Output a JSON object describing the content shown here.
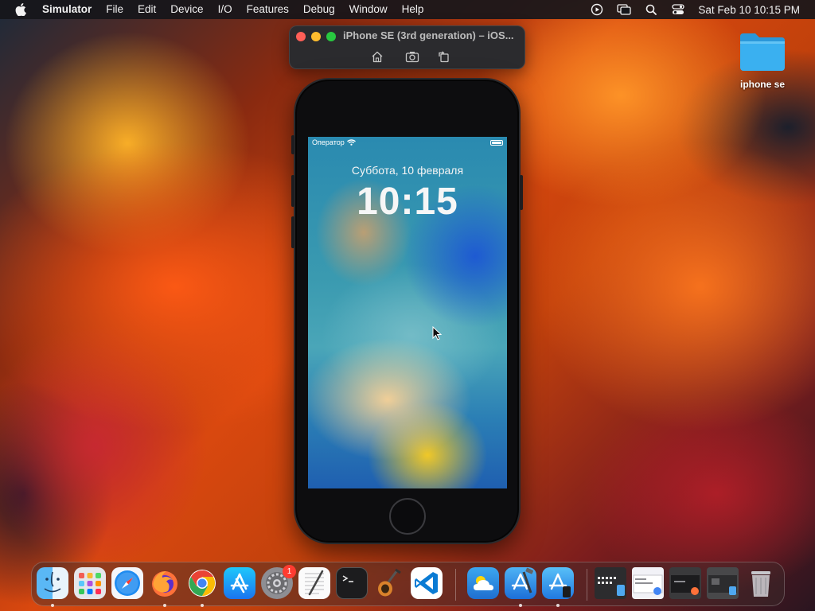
{
  "menubar": {
    "app_name": "Simulator",
    "items": [
      "File",
      "Edit",
      "Device",
      "I/O",
      "Features",
      "Debug",
      "Window",
      "Help"
    ],
    "status_icons": [
      "play-circle-icon",
      "screen-mirroring-icon",
      "search-icon",
      "control-center-icon"
    ],
    "datetime": "Sat Feb 10  10:15 PM"
  },
  "simulator_window": {
    "title": "iPhone SE (3rd generation) – iOS...",
    "tools": [
      "home-icon",
      "screenshot-icon",
      "rotate-icon"
    ]
  },
  "phone": {
    "carrier": "Оператор",
    "date": "Суббота, 10 февраля",
    "time": "10:15"
  },
  "desktop": {
    "folder_label": "iphone se"
  },
  "dock": {
    "apps": [
      "Finder",
      "Launchpad",
      "Safari",
      "Firefox",
      "Chrome",
      "App Store",
      "System Settings",
      "TextEdit",
      "Terminal",
      "Instruments",
      "Visual Studio Code",
      "Weather",
      "Xcode",
      "Simulator"
    ],
    "system_settings_badge": "1"
  },
  "colors": {
    "menubar_bg": "#16161a",
    "traffic_close": "#ff5f57",
    "traffic_min": "#febc2e",
    "traffic_max": "#28c840",
    "folder_blue": "#3ab0f0",
    "badge_red": "#ff3b30"
  }
}
